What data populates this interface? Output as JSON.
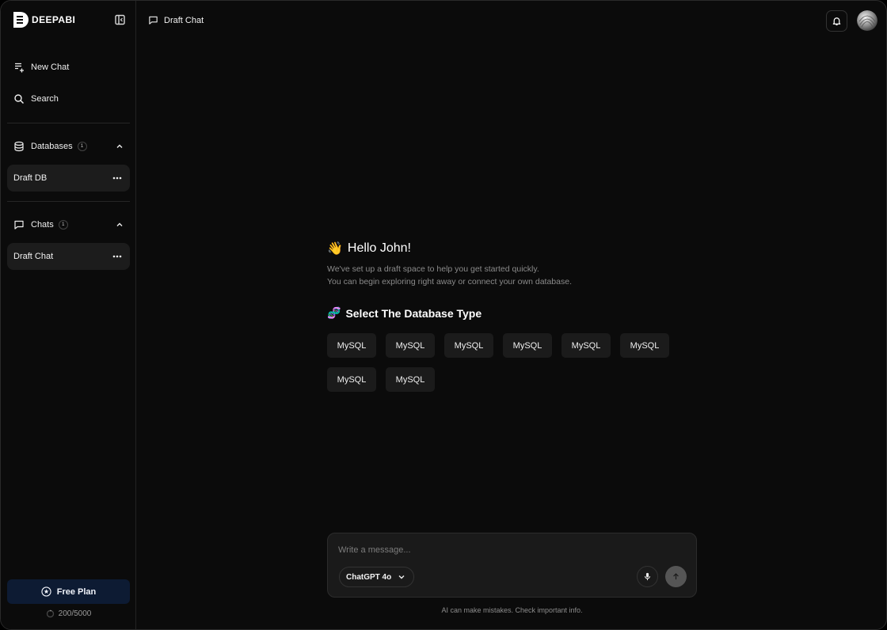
{
  "brand": {
    "name": "DEEPABI"
  },
  "sidebar": {
    "nav": [
      {
        "label": "New Chat",
        "icon": "new-chat-icon"
      },
      {
        "label": "Search",
        "icon": "search-icon"
      }
    ],
    "databases": {
      "label": "Databases",
      "count": "1",
      "items": [
        {
          "label": "Draft DB"
        }
      ]
    },
    "chats": {
      "label": "Chats",
      "count": "1",
      "items": [
        {
          "label": "Draft Chat"
        }
      ]
    },
    "plan": {
      "label": "Free Plan"
    },
    "usage": {
      "text": "200/5000",
      "used": 200,
      "total": 5000
    }
  },
  "topbar": {
    "title": "Draft Chat"
  },
  "main": {
    "greeting_emoji": "👋",
    "greeting": "Hello John!",
    "subtext_line1": "We've set up a draft space to help you get started quickly.",
    "subtext_line2": "You can begin exploring right away or connect your own database.",
    "select_emoji": "🧬",
    "select_title": "Select The Database Type",
    "db_types": [
      "MySQL",
      "MySQL",
      "MySQL",
      "MySQL",
      "MySQL",
      "MySQL",
      "MySQL",
      "MySQL"
    ]
  },
  "composer": {
    "placeholder": "Write a message...",
    "model": "ChatGPT 4o",
    "disclaimer": "AI can make mistakes. Check important info."
  },
  "colors": {
    "background": "#0b0b0b",
    "card": "#1c1c1c",
    "plan_button": "#0d1b33",
    "send_button": "#555555"
  }
}
